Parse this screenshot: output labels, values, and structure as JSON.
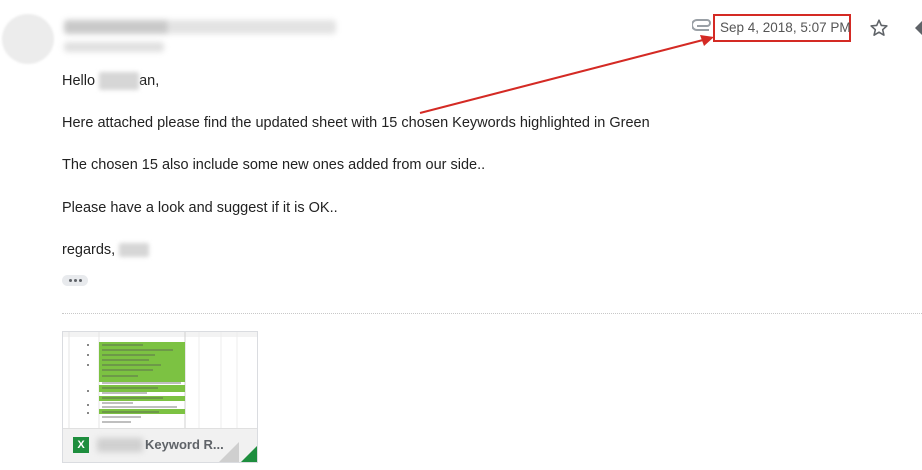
{
  "header": {
    "date": "Sep 4, 2018, 5:07 PM",
    "icons": [
      "attachment-clip-icon",
      "star-icon",
      "reply-icon"
    ],
    "annotation_color": "#d42a24"
  },
  "message": {
    "greeting_prefix": "Hello ",
    "greeting_suffix": "an,",
    "line1": "Here attached please find the updated sheet with 15 chosen Keywords highlighted in Green",
    "line2": "The chosen 15 also include some new ones added from our side..",
    "line3": "Please have a look and suggest if it is OK..",
    "signoff": "regards, "
  },
  "attachment": {
    "icon_text": "X",
    "name": "Keyword R...",
    "highlight_color": "#7cc242"
  }
}
